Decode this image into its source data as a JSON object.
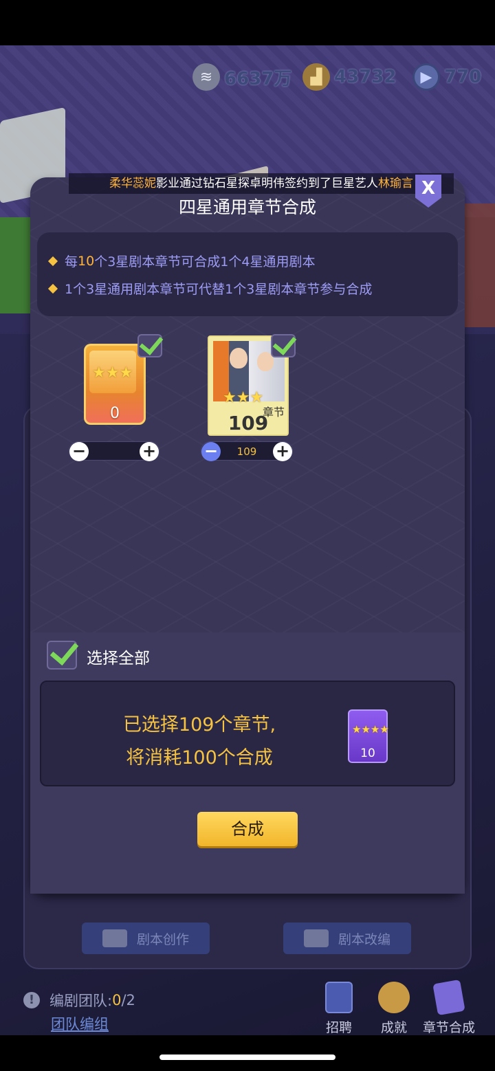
{
  "resources": {
    "money": "6637万",
    "shoes": "43732",
    "tickets": "770",
    "money_icon": "banknote-icon",
    "shoe_icon": "boot-icon",
    "ticket_icon": "play-coin-icon"
  },
  "announcement": {
    "name1": "柔华蕊妮",
    "middle": "影业通过钻石星探卓明伟签约到了巨星艺人",
    "name2": "林瑜言"
  },
  "dialog": {
    "title": "四星通用章节合成",
    "close_label": "X",
    "info": {
      "line1_pre": "每",
      "line1_num": "10",
      "line1_post": "个3星剧本章节可合成1个4星通用剧本",
      "line2": "1个3星通用剧本章节可代替1个3星剧本章节参与合成"
    },
    "cards": [
      {
        "stars": "★★★",
        "count": "0",
        "stepper_value": ""
      },
      {
        "stars": "★★★",
        "tag": "章节",
        "count": "109",
        "stepper_value": "109"
      }
    ],
    "stepper": {
      "minus": "−",
      "plus": "+"
    },
    "select_all_label": "选择全部",
    "summary": {
      "line1": "已选择109个章节,",
      "line2": "将消耗100个合成",
      "result_stars": "★★★★",
      "result_count": "10"
    },
    "compose_button": "合成"
  },
  "background_dialog": {
    "button_create": "剧本创作",
    "button_adapt": "剧本改编"
  },
  "bottom": {
    "team_label": "编剧团队:",
    "team_count": "0",
    "team_total": "/2",
    "team_link": "团队编组",
    "nav": [
      {
        "label": "招聘",
        "icon": "notebook-icon"
      },
      {
        "label": "成就",
        "icon": "medal-icon"
      },
      {
        "label": "章节合成",
        "icon": "chapter-scrolls-icon"
      }
    ]
  },
  "colors": {
    "accent_gold": "#f5c242",
    "highlight_orange": "#ffb43b",
    "info_text": "#9d9cf5",
    "check_green": "#7ed95a"
  }
}
